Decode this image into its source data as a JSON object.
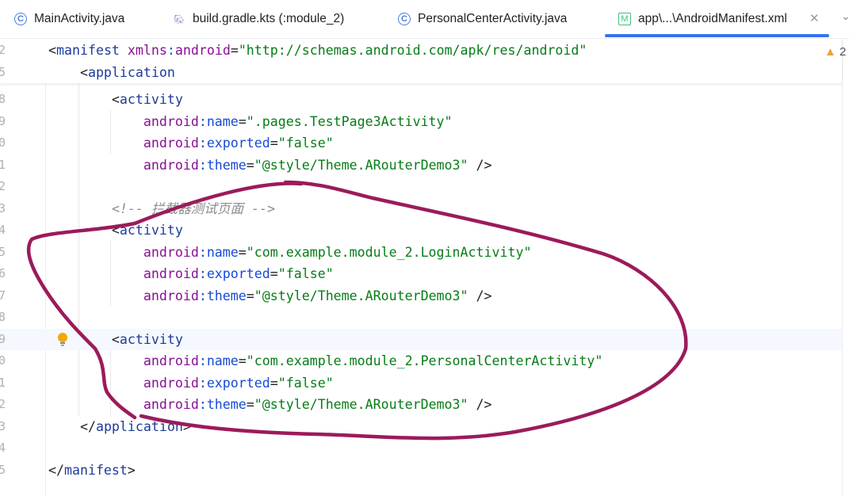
{
  "tabs": [
    {
      "label": "MainActivity.java",
      "icon": "class-icon",
      "active": false
    },
    {
      "label": "build.gradle.kts (:module_2)",
      "icon": "gradle-icon",
      "active": false
    },
    {
      "label": "PersonalCenterActivity.java",
      "icon": "class-icon",
      "active": false
    },
    {
      "label": "app\\...\\AndroidManifest.xml",
      "icon": "manifest-icon",
      "active": true
    }
  ],
  "warnings": {
    "count": "2"
  },
  "sticky_lines": [
    {
      "ln": "2",
      "tokens": [
        [
          "p",
          "<"
        ],
        [
          "tag",
          "manifest "
        ],
        [
          "ns",
          "xmlns"
        ],
        [
          "attr",
          ":"
        ],
        [
          "ns",
          "android"
        ],
        [
          "p",
          "="
        ],
        [
          "val",
          "\"http://schemas.android.com/apk/res/android\""
        ]
      ]
    },
    {
      "ln": "5",
      "tokens": [
        [
          "p",
          "    <"
        ],
        [
          "tag",
          "application"
        ]
      ]
    }
  ],
  "lines": [
    {
      "ln": "8",
      "tokens": [
        [
          "p",
          "        <"
        ],
        [
          "tag",
          "activity"
        ]
      ]
    },
    {
      "ln": "9",
      "tokens": [
        [
          "p",
          "            "
        ],
        [
          "ns",
          "android"
        ],
        [
          "attr",
          ":name"
        ],
        [
          "p",
          "="
        ],
        [
          "val",
          "\".pages.TestPage3Activity\""
        ]
      ]
    },
    {
      "ln": "0",
      "tokens": [
        [
          "p",
          "            "
        ],
        [
          "ns",
          "android"
        ],
        [
          "attr",
          ":exported"
        ],
        [
          "p",
          "="
        ],
        [
          "val",
          "\"false\""
        ]
      ]
    },
    {
      "ln": "1",
      "tokens": [
        [
          "p",
          "            "
        ],
        [
          "ns",
          "android"
        ],
        [
          "attr",
          ":theme"
        ],
        [
          "p",
          "="
        ],
        [
          "val",
          "\"@style/Theme.ARouterDemo3\""
        ],
        [
          "p",
          " />"
        ]
      ]
    },
    {
      "ln": "2",
      "tokens": []
    },
    {
      "ln": "3",
      "tokens": [
        [
          "p",
          "        "
        ],
        [
          "com",
          "<!-- 拦截器测试页面 -->"
        ]
      ]
    },
    {
      "ln": "4",
      "tokens": [
        [
          "p",
          "        <"
        ],
        [
          "tag",
          "activity"
        ]
      ]
    },
    {
      "ln": "5",
      "tokens": [
        [
          "p",
          "            "
        ],
        [
          "ns",
          "android"
        ],
        [
          "attr",
          ":name"
        ],
        [
          "p",
          "="
        ],
        [
          "val",
          "\"com.example.module_2.LoginActivity\""
        ]
      ]
    },
    {
      "ln": "6",
      "tokens": [
        [
          "p",
          "            "
        ],
        [
          "ns",
          "android"
        ],
        [
          "attr",
          ":exported"
        ],
        [
          "p",
          "="
        ],
        [
          "val",
          "\"false\""
        ]
      ]
    },
    {
      "ln": "7",
      "tokens": [
        [
          "p",
          "            "
        ],
        [
          "ns",
          "android"
        ],
        [
          "attr",
          ":theme"
        ],
        [
          "p",
          "="
        ],
        [
          "val",
          "\"@style/Theme.ARouterDemo3\""
        ],
        [
          "p",
          " />"
        ]
      ]
    },
    {
      "ln": "8",
      "tokens": []
    },
    {
      "ln": "9",
      "tokens": [
        [
          "p",
          "        <"
        ],
        [
          "tag",
          "activity"
        ]
      ],
      "current": true
    },
    {
      "ln": "0",
      "tokens": [
        [
          "p",
          "            "
        ],
        [
          "ns",
          "android"
        ],
        [
          "attr",
          ":name"
        ],
        [
          "p",
          "="
        ],
        [
          "val",
          "\"com.example.module_2.PersonalCenterActivity\""
        ]
      ]
    },
    {
      "ln": "1",
      "tokens": [
        [
          "p",
          "            "
        ],
        [
          "ns",
          "android"
        ],
        [
          "attr",
          ":exported"
        ],
        [
          "p",
          "="
        ],
        [
          "val",
          "\"false\""
        ]
      ]
    },
    {
      "ln": "2",
      "tokens": [
        [
          "p",
          "            "
        ],
        [
          "ns",
          "android"
        ],
        [
          "attr",
          ":theme"
        ],
        [
          "p",
          "="
        ],
        [
          "val",
          "\"@style/Theme.ARouterDemo3\""
        ],
        [
          "p",
          " />"
        ]
      ]
    },
    {
      "ln": "3",
      "tokens": [
        [
          "p",
          "    </"
        ],
        [
          "tag",
          "application"
        ],
        [
          "p",
          ">"
        ]
      ]
    },
    {
      "ln": "4",
      "tokens": []
    },
    {
      "ln": "5",
      "tokens": [
        [
          "p",
          "</"
        ],
        [
          "tag",
          "manifest"
        ],
        [
          "p",
          ">"
        ]
      ]
    }
  ],
  "colors": {
    "accent": "#3574f0",
    "annotation": "#9b1b5a",
    "warning": "#e8a33d"
  }
}
